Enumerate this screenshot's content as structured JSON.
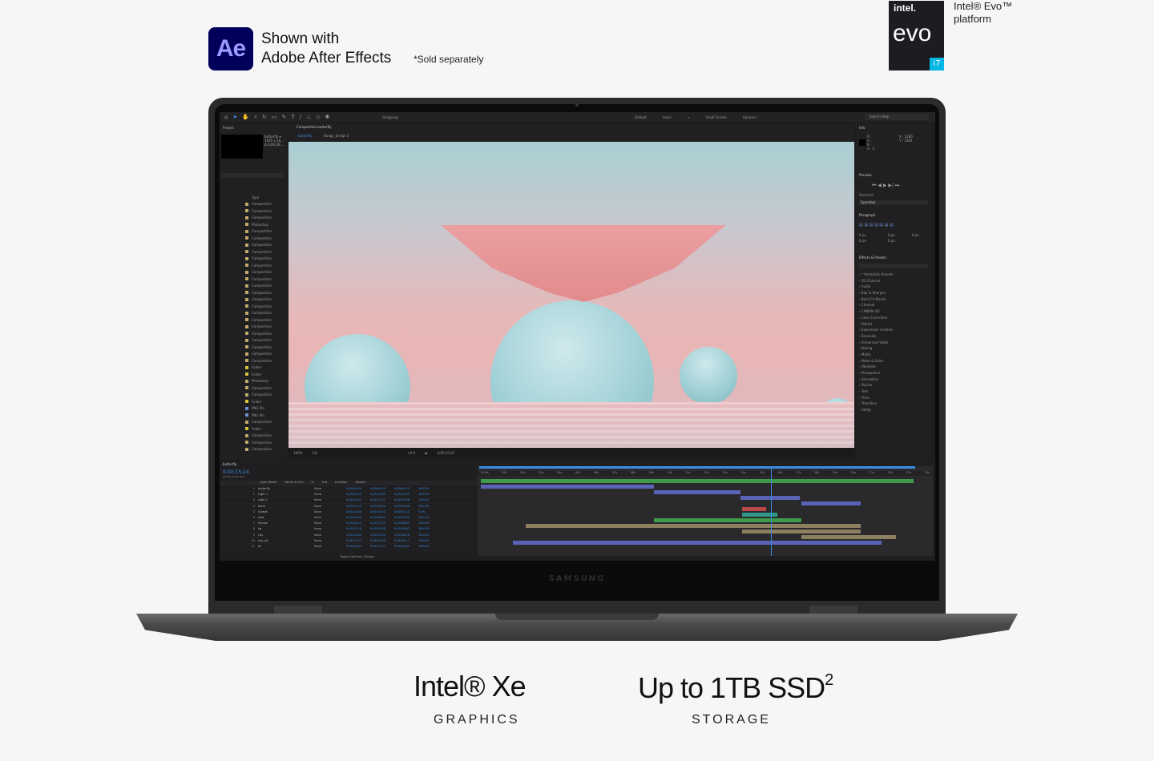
{
  "adobe": {
    "logo": "Ae",
    "line1": "Shown with",
    "line2": "Adobe After Effects",
    "note": "*Sold separately"
  },
  "intel_badge": {
    "intel": "intel.",
    "evo": "evo",
    "tier": "i7",
    "line1": "Intel® Evo™",
    "line2": "platform"
  },
  "laptop": {
    "brand": "SAMSUNG"
  },
  "ae_app": {
    "toolbar": {
      "snapping": "Snapping",
      "workspaces": [
        "Default",
        "Learn",
        "»",
        "Small Screen",
        "Libraries"
      ],
      "search_placeholder": "Search Help"
    },
    "project_panel": {
      "title": "Project",
      "comp_name": "butterfly ▾",
      "info_line1": "1920 x 10...",
      "info_line2": "Δ 0;00;26;..."
    },
    "project_list": [
      {
        "name": "Type"
      },
      {
        "name": "Composition"
      },
      {
        "name": "Composition"
      },
      {
        "name": "Composition"
      },
      {
        "name": "Photoshop"
      },
      {
        "name": "Composition"
      },
      {
        "name": "Composition"
      },
      {
        "name": "Composition"
      },
      {
        "name": "Composition"
      },
      {
        "name": "Composition"
      },
      {
        "name": "Composition"
      },
      {
        "name": "Composition"
      },
      {
        "name": "Composition"
      },
      {
        "name": "Composition"
      },
      {
        "name": "Composition"
      },
      {
        "name": "Composition"
      },
      {
        "name": "Composition"
      },
      {
        "name": "Composition"
      },
      {
        "name": "Composition"
      },
      {
        "name": "Composition"
      },
      {
        "name": "Composition"
      },
      {
        "name": "Composition"
      },
      {
        "name": "Composition"
      },
      {
        "name": "Composition"
      },
      {
        "name": "Composition"
      },
      {
        "name": "Folder"
      },
      {
        "name": "Folder"
      },
      {
        "name": "Photoshop"
      },
      {
        "name": "Composition"
      },
      {
        "name": "Composition"
      },
      {
        "name": "Folder"
      },
      {
        "name": "PNG file"
      },
      {
        "name": "PNG file"
      },
      {
        "name": "Composition"
      },
      {
        "name": "Folder"
      },
      {
        "name": "Composition"
      },
      {
        "name": "Composition"
      },
      {
        "name": "Composition"
      }
    ],
    "comp": {
      "title": "Composition butterfly",
      "tab_active": "butterfly",
      "tab_other": "Badge_bridge 2"
    },
    "viewer_bar": {
      "zoom": "100%",
      "res": "Full",
      "exposure": "+0.0",
      "time": "0;00;15;22"
    },
    "right_panel": {
      "info_title": "Info",
      "info_rgb": [
        "R :",
        "G :",
        "B :",
        "A : 0"
      ],
      "info_coords": [
        "X : 2180",
        "Y : 1282"
      ],
      "preview_title": "Preview",
      "shortcut_label": "Shortcut",
      "shortcut_value": "Spacebar",
      "paragraph_title": "Paragraph",
      "para_values": [
        "0 px",
        "0 px",
        "0 px",
        "0 px",
        "0 px"
      ],
      "effects_title": "Effects & Presets",
      "effects": [
        "* Animation Presets",
        "3D Channel",
        "Audio",
        "Blur & Sharpen",
        "Boris FX Mocha",
        "Channel",
        "CINEMA 4D",
        "Color Correction",
        "Distort",
        "Expression Controls",
        "Generate",
        "Immersive Video",
        "Keying",
        "Matte",
        "Noise & Grain",
        "Obsolete",
        "Perspective",
        "Simulation",
        "Stylize",
        "Text",
        "Time",
        "Transition",
        "Utility"
      ]
    },
    "timeline": {
      "comp_tab": "butterfly",
      "current_time": "0;00;15;24",
      "fps": "00474 (29.97 fps)",
      "columns": [
        "Layer Name",
        "Parent & Link",
        "In",
        "Out",
        "Duration",
        "Stretch"
      ],
      "layers": [
        {
          "num": "1",
          "name": "butterfly",
          "mode": "None",
          "in": "0;00;00;00",
          "out": "0;00;09;13",
          "dur": "0;00;09;13",
          "pct": "100.0%"
        },
        {
          "num": "2",
          "name": "Light 1",
          "mode": "None",
          "in": "0;00;00;12",
          "out": "0;00;14;04",
          "dur": "0;00;14;23",
          "pct": "100.0%"
        },
        {
          "num": "3",
          "name": "Light 2",
          "mode": "None",
          "in": "0;00;14;05",
          "out": "0;00;17;12",
          "dur": "0;00;03;08",
          "pct": "100.0%"
        },
        {
          "num": "4",
          "name": "black",
          "mode": "None",
          "in": "0;00;17;13",
          "out": "0;00;20;20",
          "dur": "0;00;03;08",
          "pct": "100.0%"
        },
        {
          "num": "5",
          "name": "Sizesel",
          "mode": "None",
          "in": "0;00;14;05",
          "out": "0;00;15;17",
          "dur": "0;00;01;13",
          "pct": "7.0%"
        },
        {
          "num": "6",
          "name": "Leaf",
          "mode": "None",
          "in": "0;00;14;05",
          "out": "0;00;18;04",
          "dur": "0;00;02;00",
          "pct": "100.0%"
        },
        {
          "num": "7",
          "name": "mouse",
          "mode": "None",
          "in": "0;00;09;12",
          "out": "0;00;17;12",
          "dur": "0;00;08;01",
          "pct": "100.0%"
        },
        {
          "num": "8",
          "name": "bg",
          "mode": "None",
          "in": "0;00;02;14",
          "out": "0;00;20;20",
          "dur": "0;00;18;07",
          "pct": "100.0%"
        },
        {
          "num": "9",
          "name": "city",
          "mode": "None",
          "in": "0;00;14;05",
          "out": "0;00;20;20",
          "dur": "0;00;06;16",
          "pct": "100.0%"
        },
        {
          "num": "10",
          "name": "city_alt",
          "mode": "None",
          "in": "0;00;17;13",
          "out": "0;00;26;29",
          "dur": "0;00;09;17",
          "pct": "100.0%"
        },
        {
          "num": "11",
          "name": "all",
          "mode": "None",
          "in": "0;00;00;24",
          "out": "0;00;21;21",
          "dur": "0;00;20;00",
          "pct": "100.0%"
        }
      ],
      "ruler": [
        "0:00s",
        "01s",
        "02s",
        "03s",
        "04s",
        "05s",
        "06s",
        "07s",
        "08s",
        "09s",
        "10s",
        "11s",
        "12s",
        "13s",
        "14s",
        "15s",
        "16s",
        "17s",
        "18s",
        "19s",
        "20s",
        "21s",
        "22s",
        "23s",
        "24s"
      ],
      "footer": "Toggle Switches / Modes"
    }
  },
  "specs": [
    {
      "title": "Intel® Xe",
      "label": "GRAPHICS"
    },
    {
      "title": "Up to 1TB SSD",
      "sup": "2",
      "label": "STORAGE"
    }
  ]
}
